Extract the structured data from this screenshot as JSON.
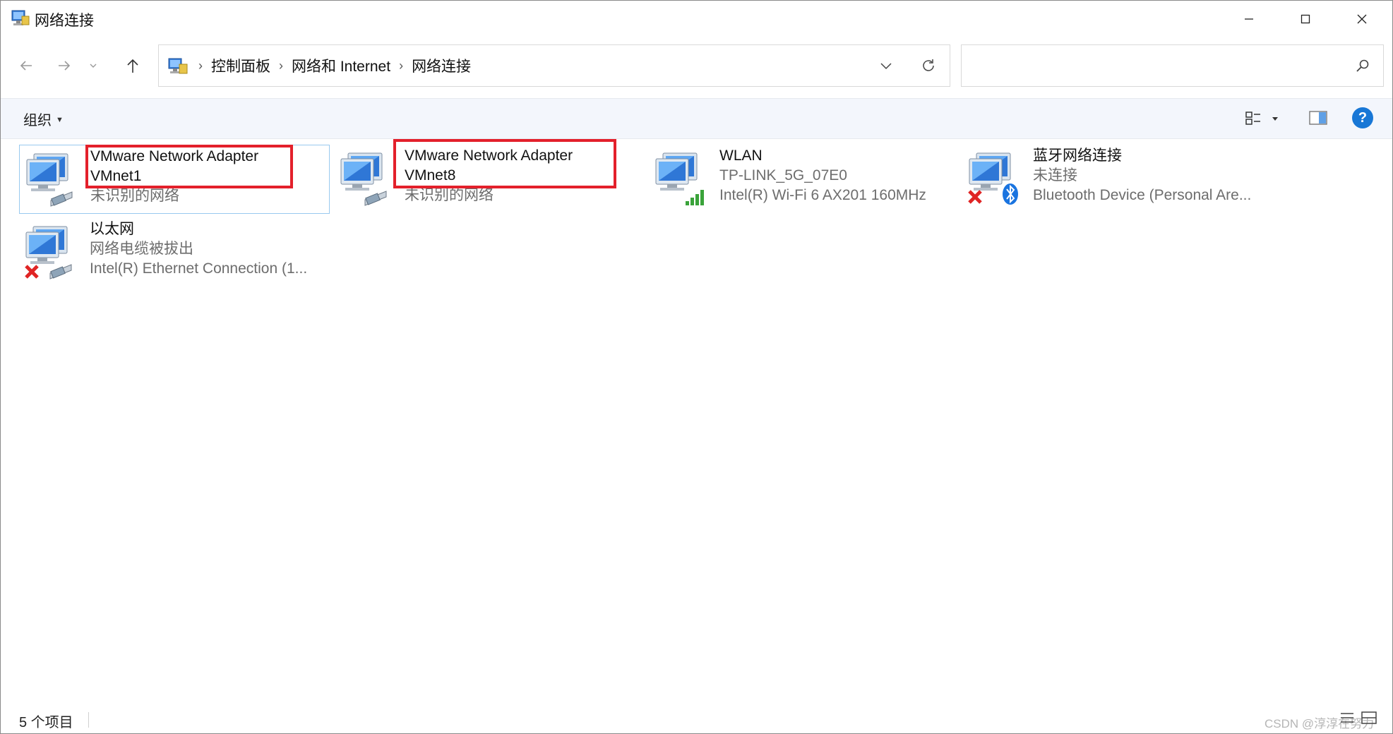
{
  "window": {
    "title": "网络连接"
  },
  "address": {
    "crumbs": [
      "控制面板",
      "网络和 Internet",
      "网络连接"
    ],
    "separator": "›"
  },
  "search": {
    "placeholder": ""
  },
  "toolbar": {
    "organize_label": "组织",
    "help_label": "?"
  },
  "items": [
    {
      "name": "VMware Network Adapter",
      "name2": "VMnet1",
      "sub1": "未识别的网络",
      "sub2": "",
      "icon": "network-adapter-icon",
      "selected": true,
      "highlighted": true
    },
    {
      "name": "VMware Network Adapter",
      "name2": "VMnet8",
      "sub1": "未识别的网络",
      "sub2": "",
      "icon": "network-adapter-icon",
      "selected": false,
      "highlighted": true
    },
    {
      "name": "WLAN",
      "sub1": "TP-LINK_5G_07E0",
      "sub2": "Intel(R) Wi-Fi 6 AX201 160MHz",
      "icon": "wifi-adapter-icon"
    },
    {
      "name": "蓝牙网络连接",
      "sub1": "未连接",
      "sub2": "Bluetooth Device (Personal Are...",
      "icon": "bluetooth-adapter-icon",
      "status": "disconnected"
    },
    {
      "name": "以太网",
      "sub1": "网络电缆被拔出",
      "sub2": "Intel(R) Ethernet Connection (1...",
      "icon": "ethernet-adapter-icon",
      "status": "disconnected"
    }
  ],
  "status": {
    "count_text": "5 个项目"
  },
  "watermark": "CSDN @淳淳在努力",
  "colors": {
    "accent": "#1877d6",
    "highlight_border": "#e3202b",
    "selection_border": "#99c9ef",
    "disconnected_x": "#e02424"
  }
}
